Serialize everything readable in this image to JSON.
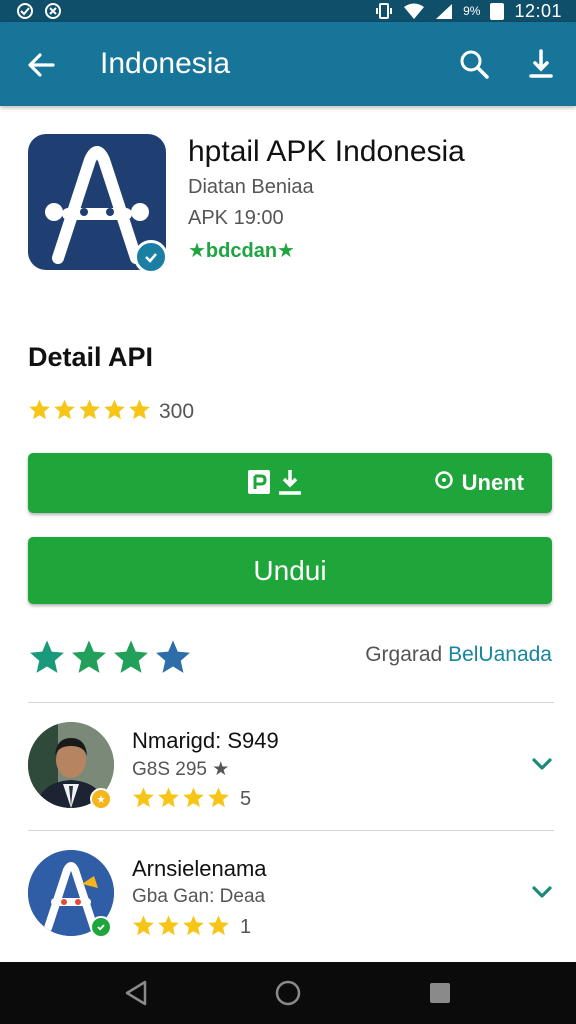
{
  "status_bar": {
    "clock": "12:01",
    "battery_label": "9%",
    "icons": [
      "notification-icon",
      "notification-icon-2",
      "vibrate-icon",
      "wifi-icon",
      "signal-icon",
      "battery-icon"
    ]
  },
  "app_bar": {
    "title": "Indonesia",
    "back_icon": "arrow-back-icon",
    "search_icon": "search-icon",
    "download_icon": "download-icon",
    "color": "#17759a"
  },
  "app": {
    "name": "hptail APK Indonesia",
    "developer": "Diatan Beniaa",
    "version": "APK 19:00",
    "tag": "★bdcdan★",
    "icon": "app-logo-icon",
    "verified_icon": "check-badge-icon"
  },
  "detail": {
    "title": "Detail API",
    "rating_stars": 5,
    "rating_count": "300"
  },
  "actions": {
    "left_icons": [
      "p-icon",
      "download-tray-icon"
    ],
    "right_label": "Unent",
    "right_icon": "chat-icon",
    "download_label": "Undui",
    "button_color": "#1fa63a"
  },
  "rating_summary": {
    "stars": 4,
    "caption_prefix": "Grgarad",
    "caption_link": "BelUanada",
    "star_color": "#1a9a7a",
    "last_star_color": "#2d6da8"
  },
  "reviews": [
    {
      "name": "Nmarigd: S949",
      "meta": "G8S 295 ★",
      "stars": 4,
      "score": "5",
      "avatar": "person-avatar-icon",
      "badge_color": "#f5b51b"
    },
    {
      "name": "Arnsielenama",
      "meta": "Gba Gan: Deaa",
      "stars": 4,
      "score": "1",
      "avatar": "app-logo-avatar-icon",
      "badge_color": "#1fa63a"
    }
  ],
  "nav_bar": {
    "icons": [
      "back-triangle-icon",
      "home-circle-icon",
      "recents-square-icon"
    ]
  }
}
